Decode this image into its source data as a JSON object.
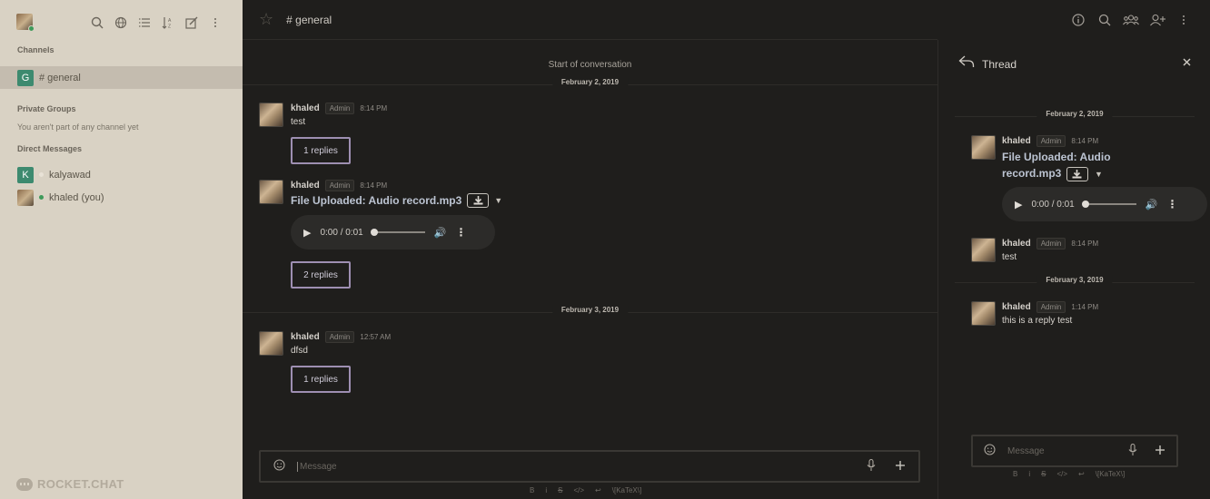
{
  "sidebar": {
    "sections": {
      "channels": "Channels",
      "private_groups": "Private Groups",
      "private_groups_empty": "You aren't part of any channel yet",
      "direct_messages": "Direct Messages"
    },
    "channels": [
      {
        "avatar_letter": "G",
        "label": "# general",
        "color": "#3d8a6f"
      }
    ],
    "direct_messages": [
      {
        "avatar_letter": "K",
        "label": "kalyawad",
        "color": "#3d8a6f",
        "status_color": "#d9d2c4"
      },
      {
        "label": "khaled (you)",
        "status_color": "#3e9a5a"
      }
    ],
    "logo_text": "ROCKET.CHAT"
  },
  "header": {
    "room_title": "# general"
  },
  "conversation": {
    "start_text": "Start of conversation",
    "dates": [
      "February 2, 2019",
      "February 3, 2019"
    ],
    "messages": [
      {
        "user": "khaled",
        "role": "Admin",
        "time": "8:14 PM",
        "text": "test",
        "replies": "1 replies"
      },
      {
        "user": "khaled",
        "role": "Admin",
        "time": "8:14 PM",
        "file_title": "File Uploaded: Audio record.mp3",
        "audio_time": "0:00 / 0:01",
        "replies": "2 replies"
      },
      {
        "user": "khaled",
        "role": "Admin",
        "time": "12:57 AM",
        "text": "dfsd",
        "replies": "1 replies"
      }
    ]
  },
  "composer": {
    "placeholder": "Message",
    "format_items": [
      "B",
      "i",
      "S",
      "</>",
      "↩",
      "\\[KaTeX\\]"
    ]
  },
  "thread": {
    "title": "Thread",
    "dates": [
      "February 2, 2019",
      "February 3, 2019"
    ],
    "messages": [
      {
        "user": "khaled",
        "role": "Admin",
        "time": "8:14 PM",
        "file_title": "File Uploaded: Audio record.mp3",
        "audio_time": "0:00 / 0:01"
      },
      {
        "user": "khaled",
        "role": "Admin",
        "time": "8:14 PM",
        "text": "test"
      },
      {
        "user": "khaled",
        "role": "Admin",
        "time": "1:14 PM",
        "text": "this is a reply test"
      }
    ],
    "composer_placeholder": "Message"
  },
  "colors": {
    "accent_reply_border": "#9e8fb2",
    "sidebar_bg": "#d9d2c4",
    "main_bg": "#1f1e1c"
  }
}
